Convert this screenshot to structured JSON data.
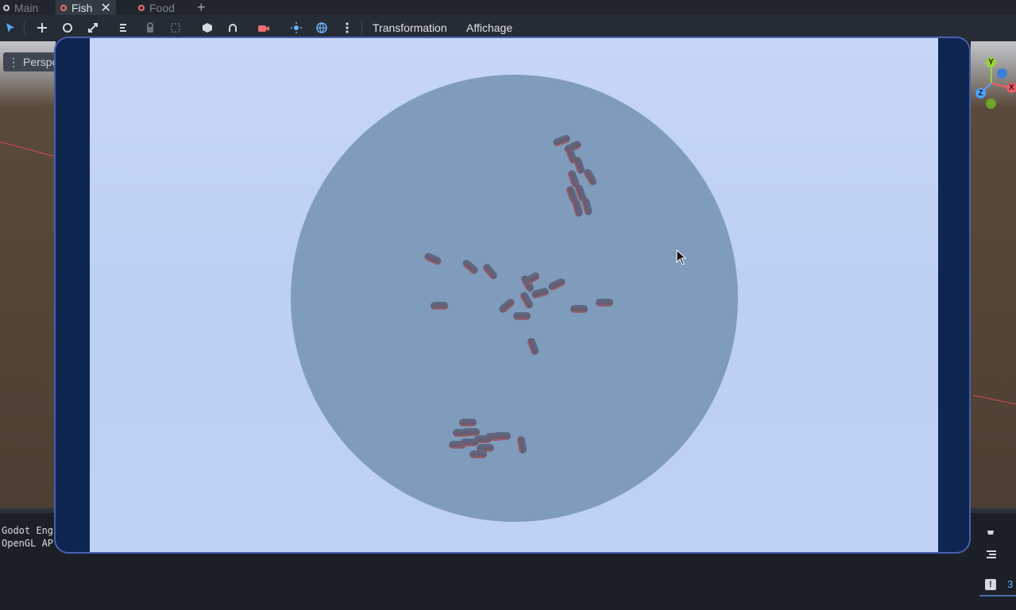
{
  "tabs": [
    {
      "label": "Main"
    },
    {
      "label": "Fish"
    },
    {
      "label": "Food"
    }
  ],
  "tabs_close": "✕",
  "tabs_add": "+",
  "toolbar": {
    "transformation": "Transformation",
    "affichage": "Affichage"
  },
  "viewport": {
    "perspective_label": "Perspe"
  },
  "gizmo": {
    "y": "Y",
    "x": "X",
    "z": "Z"
  },
  "console": {
    "line1": "Godot Eng",
    "line2": "OpenGL AP"
  },
  "bottom_right": {
    "count": "3"
  },
  "colors": {
    "accent": "#4a5fb3",
    "sky": "#c7d6f6",
    "sphere": "#809cbc",
    "tab_active": "#ef6f6f"
  }
}
